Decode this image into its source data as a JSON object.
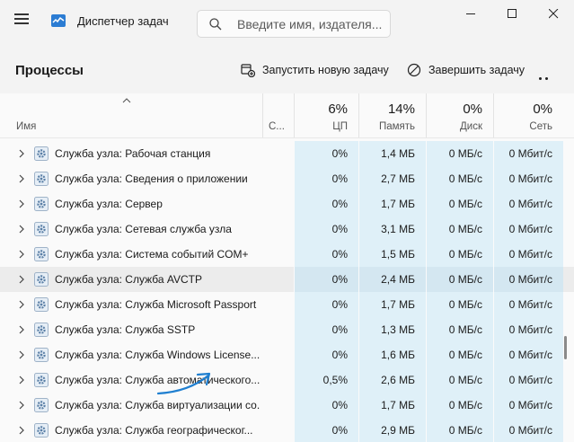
{
  "app": {
    "title": "Диспетчер задач"
  },
  "search": {
    "placeholder": "Введите имя, издателя..."
  },
  "page": {
    "title": "Процессы"
  },
  "toolbar": {
    "run_task": "Запустить новую задачу",
    "end_task": "Завершить задачу"
  },
  "columns": {
    "name": "Имя",
    "status": "С...",
    "cpu": {
      "pct": "6%",
      "label": "ЦП"
    },
    "memory": {
      "pct": "14%",
      "label": "Память"
    },
    "disk": {
      "pct": "0%",
      "label": "Диск"
    },
    "network": {
      "pct": "0%",
      "label": "Сеть"
    }
  },
  "rows": [
    {
      "name": "Служба узла: Рабочая станция",
      "cpu": "0%",
      "mem": "1,4 МБ",
      "disk": "0 МБ/с",
      "net": "0 Мбит/с"
    },
    {
      "name": "Служба узла: Сведения о приложении",
      "cpu": "0%",
      "mem": "2,7 МБ",
      "disk": "0 МБ/с",
      "net": "0 Мбит/с"
    },
    {
      "name": "Служба узла: Сервер",
      "cpu": "0%",
      "mem": "1,7 МБ",
      "disk": "0 МБ/с",
      "net": "0 Мбит/с"
    },
    {
      "name": "Служба узла: Сетевая служба узла",
      "cpu": "0%",
      "mem": "3,1 МБ",
      "disk": "0 МБ/с",
      "net": "0 Мбит/с"
    },
    {
      "name": "Служба узла: Система событий COM+",
      "cpu": "0%",
      "mem": "1,5 МБ",
      "disk": "0 МБ/с",
      "net": "0 Мбит/с"
    },
    {
      "name": "Служба узла: Служба AVCTP",
      "cpu": "0%",
      "mem": "2,4 МБ",
      "disk": "0 МБ/с",
      "net": "0 Мбит/с"
    },
    {
      "name": "Служба узла: Служба Microsoft Passport",
      "cpu": "0%",
      "mem": "1,7 МБ",
      "disk": "0 МБ/с",
      "net": "0 Мбит/с"
    },
    {
      "name": "Служба узла: Служба SSTP",
      "cpu": "0%",
      "mem": "1,3 МБ",
      "disk": "0 МБ/с",
      "net": "0 Мбит/с"
    },
    {
      "name": "Служба узла: Служба Windows License...",
      "cpu": "0%",
      "mem": "1,6 МБ",
      "disk": "0 МБ/с",
      "net": "0 Мбит/с"
    },
    {
      "name": "Служба узла: Служба автоматического...",
      "cpu": "0,5%",
      "mem": "2,6 МБ",
      "disk": "0 МБ/с",
      "net": "0 Мбит/с"
    },
    {
      "name": "Служба узла: Служба виртуализации со...",
      "cpu": "0%",
      "mem": "1,7 МБ",
      "disk": "0 МБ/с",
      "net": "0 Мбит/с"
    },
    {
      "name": "Служба узла: Служба географическог...",
      "cpu": "0%",
      "mem": "2,9 МБ",
      "disk": "0 МБ/с",
      "net": "0 Мбит/с"
    }
  ],
  "colors": {
    "accent": "#0067c0",
    "metric_bg": "#dff0f8",
    "annotation": "#1f7fd0"
  }
}
